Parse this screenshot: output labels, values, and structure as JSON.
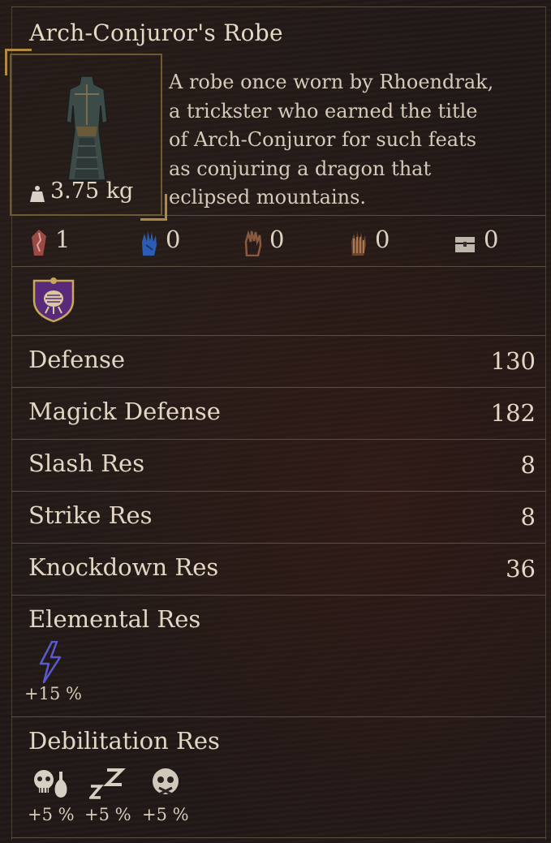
{
  "item": {
    "name": "Arch-Conjuror's Robe",
    "weight": "3.75 kg",
    "description_lines": [
      "A robe once worn by Rhoendrak,",
      "a trickster who earned the title",
      "of Arch-Conjuror for such feats",
      "as conjuring a dragon that",
      "eclipsed mountains."
    ],
    "icon": "robe-armor-icon",
    "emblem_icon": "mage-vocation-crest-icon"
  },
  "slots": [
    {
      "icon": "rift-crystal-icon",
      "value": "1",
      "color": "#c2655e"
    },
    {
      "icon": "blue-hand-icon",
      "value": "0",
      "color": "#3c6fd0"
    },
    {
      "icon": "brown-hand-icon",
      "value": "0",
      "color": "#8a5a40"
    },
    {
      "icon": "striped-hand-icon",
      "value": "0",
      "color": "#9a6a45"
    },
    {
      "icon": "chest-icon",
      "value": "0",
      "color": "#b9b3aa"
    }
  ],
  "stats": [
    {
      "label": "Defense",
      "value": "130"
    },
    {
      "label": "Magick Defense",
      "value": "182"
    },
    {
      "label": "Slash Res",
      "value": "8"
    },
    {
      "label": "Strike Res",
      "value": "8"
    },
    {
      "label": "Knockdown Res",
      "value": "36"
    }
  ],
  "elemental": {
    "label": "Elemental Res",
    "items": [
      {
        "icon": "lightning-icon",
        "value": "+15 %"
      }
    ]
  },
  "debilitation": {
    "label": "Debilitation Res",
    "items": [
      {
        "icon": "poison-skull-icon",
        "value": "+5 %"
      },
      {
        "icon": "sleep-icon",
        "value": "+5 %"
      },
      {
        "icon": "silence-skull-icon",
        "value": "+5 %"
      }
    ]
  }
}
